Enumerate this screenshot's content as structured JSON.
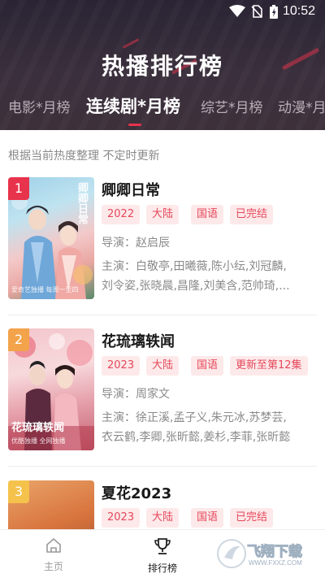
{
  "status_bar": {
    "time": "10:52"
  },
  "header": {
    "title": "热播排行榜"
  },
  "tabs": [
    {
      "label": "电影*月榜"
    },
    {
      "label": "连续剧*月榜"
    },
    {
      "label": "综艺*月榜"
    },
    {
      "label": "动漫*月榜"
    }
  ],
  "notice": "根据当前热度整理 不定时更新",
  "items": [
    {
      "rank": "1",
      "title": "卿卿日常",
      "tags": [
        "2022",
        "大陆",
        "国语",
        "已完结"
      ],
      "director": "导演：赵启辰",
      "cast_line1": "主演：白敬亭,田曦薇,陈小纭,刘冠麟,",
      "cast_line2": "刘令姿,张晓晨,昌隆,刘美含,范帅琦,...",
      "poster_logo": "卿卿日常",
      "poster_caption": "爱奇艺独播 每周一至四"
    },
    {
      "rank": "2",
      "title": "花琉璃轶闻",
      "tags": [
        "2023",
        "大陆",
        "国语",
        "更新至第12集"
      ],
      "director": "导演：周家文",
      "cast_line1": "主演：徐正溪,孟子义,朱元冰,苏梦芸,",
      "cast_line2": "衣云鹤,李卿,张昕懿,姜杉,李菲,张昕懿",
      "poster_logo": "花琉璃轶闻",
      "poster_caption": "优酷独播 全网独播"
    },
    {
      "rank": "3",
      "title": "夏花2023",
      "tags": [
        "2023",
        "大陆",
        "国语",
        "已完结"
      ]
    }
  ],
  "bottom_nav": [
    {
      "label": "主页",
      "icon": "home-icon"
    },
    {
      "label": "排行榜",
      "icon": "trophy-icon"
    }
  ],
  "watermark": {
    "text": "飞翔下载",
    "url": "WWW.FXXZ.COM"
  },
  "colors": {
    "accent": "#e8334c",
    "tag_bg": "#fde9ea",
    "tag_text": "#e5485a",
    "rank1": "#e8334c",
    "rank2": "#f3a34a",
    "rank3": "#f5c24c"
  }
}
